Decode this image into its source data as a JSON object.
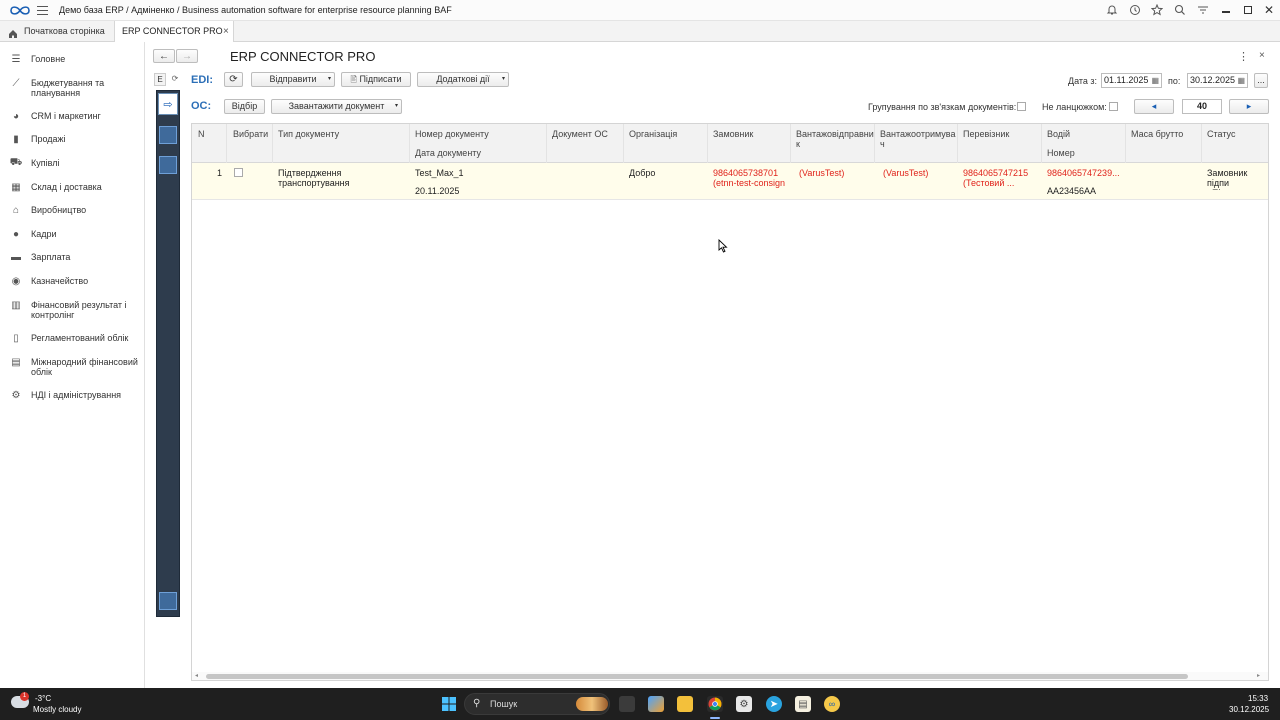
{
  "app": {
    "title": "Демо база ERP / Адміненко / Business automation software for enterprise resource planning BAF"
  },
  "tabs": [
    {
      "label": "Початкова сторінка"
    },
    {
      "label": "ERP CONNECTOR PRO",
      "close": "×"
    }
  ],
  "sidebar": {
    "items": [
      {
        "label": "Головне",
        "icon": "menu-icon"
      },
      {
        "label": "Бюджетування та планування",
        "icon": "chart-line-icon"
      },
      {
        "label": "CRM і маркетинг",
        "icon": "pie-chart-icon"
      },
      {
        "label": "Продажі",
        "icon": "bag-icon"
      },
      {
        "label": "Купівлі",
        "icon": "cart-icon"
      },
      {
        "label": "Склад і доставка",
        "icon": "warehouse-icon"
      },
      {
        "label": "Виробництво",
        "icon": "factory-icon"
      },
      {
        "label": "Кадри",
        "icon": "person-icon"
      },
      {
        "label": "Зарплата",
        "icon": "wallet-icon"
      },
      {
        "label": "Казначейство",
        "icon": "coin-icon"
      },
      {
        "label": "Фінансовий результат і контролінг",
        "icon": "bar-chart-icon"
      },
      {
        "label": "Регламентований облік",
        "icon": "document-icon"
      },
      {
        "label": "Міжнародний фінансовий облік",
        "icon": "book-icon"
      },
      {
        "label": "НДІ і адміністрування",
        "icon": "gear-icon"
      }
    ]
  },
  "strip": {
    "tab_e": "E"
  },
  "page": {
    "title": "ERP CONNECTOR PRO"
  },
  "toolbar": {
    "edi_label": "EDI:",
    "send": "Відправити",
    "sign": "Підписати",
    "extra": "Додаткові дії",
    "date_from_label": "Дата з:",
    "date_from": "01.11.2025",
    "date_to_label": "по:",
    "date_to": "30.12.2025",
    "more": "...",
    "os_label": "ОС:",
    "select": "Відбір",
    "load_doc": "Завантажити документ",
    "grouping_label": "Групування по зв'язкам документів:",
    "no_chain_label": "Не ланцюжком:",
    "prev": "◂",
    "page_size": "40",
    "next": "▸"
  },
  "table": {
    "headers": {
      "n": "N",
      "select": "Вибрати",
      "doc_type": "Тип документу",
      "doc_number": "Номер документу",
      "doc_date": "Дата документу",
      "doc_os": "Документ ОС",
      "org": "Організація",
      "customer": "Замовник",
      "shipper": "Вантажовідправник",
      "consignee": "Вантажоотримувач",
      "carrier": "Перевізник",
      "driver": "Водій",
      "number": "Номер",
      "gross": "Маса брутто",
      "status": "Статус"
    },
    "rows": [
      {
        "n": "1",
        "doc_type": "Підтвердження транспортування",
        "doc_number": "Test_Max_1",
        "doc_date": "20.11.2025",
        "org": "Добро",
        "customer": "9864065738701 (etnn-test-consign",
        "shipper": "(VarusTest)",
        "consignee": "(VarusTest)",
        "carrier": "9864065747215 (Тестовий ...",
        "driver": "9864065747239...",
        "number": "AA23456AA",
        "status": "Замовник підпи «Підтвердженн"
      }
    ]
  },
  "taskbar": {
    "weather_temp": "-3°C",
    "weather_desc": "Mostly cloudy",
    "weather_badge": "1",
    "search": "Пошук",
    "time": "15:33",
    "date": "30.12.2025"
  }
}
